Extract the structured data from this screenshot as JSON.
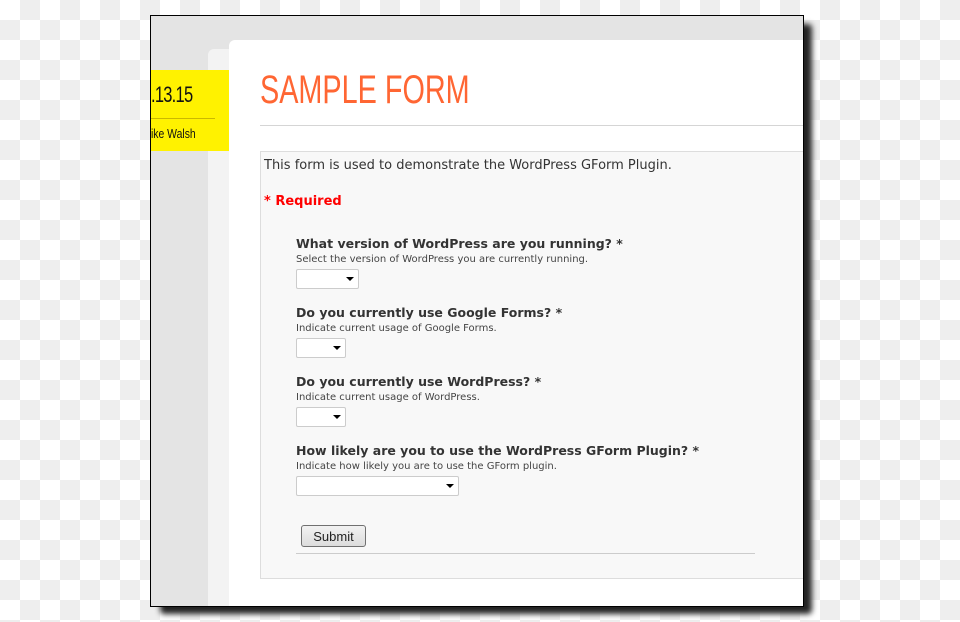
{
  "sidebar": {
    "date": ".13.15",
    "author": "ike Walsh"
  },
  "page": {
    "title": "SAMPLE FORM"
  },
  "form": {
    "description": "This form is used to demonstrate the WordPress GForm Plugin.",
    "required_note": "* Required",
    "questions": [
      {
        "label": "What version of WordPress are you running? *",
        "help": "Select the version of WordPress you are currently running.",
        "value": ""
      },
      {
        "label": "Do you currently use Google Forms? *",
        "help": "Indicate current usage of Google Forms.",
        "value": ""
      },
      {
        "label": "Do you currently use WordPress? *",
        "help": "Indicate current usage of WordPress.",
        "value": ""
      },
      {
        "label": "How likely are you to use the WordPress GForm Plugin? *",
        "help": "Indicate how likely you are to use the GForm plugin.",
        "value": ""
      }
    ],
    "submit_label": "Submit"
  },
  "colors": {
    "title": "#ff6633",
    "required": "#ff0000",
    "date_box": "#fff200"
  }
}
